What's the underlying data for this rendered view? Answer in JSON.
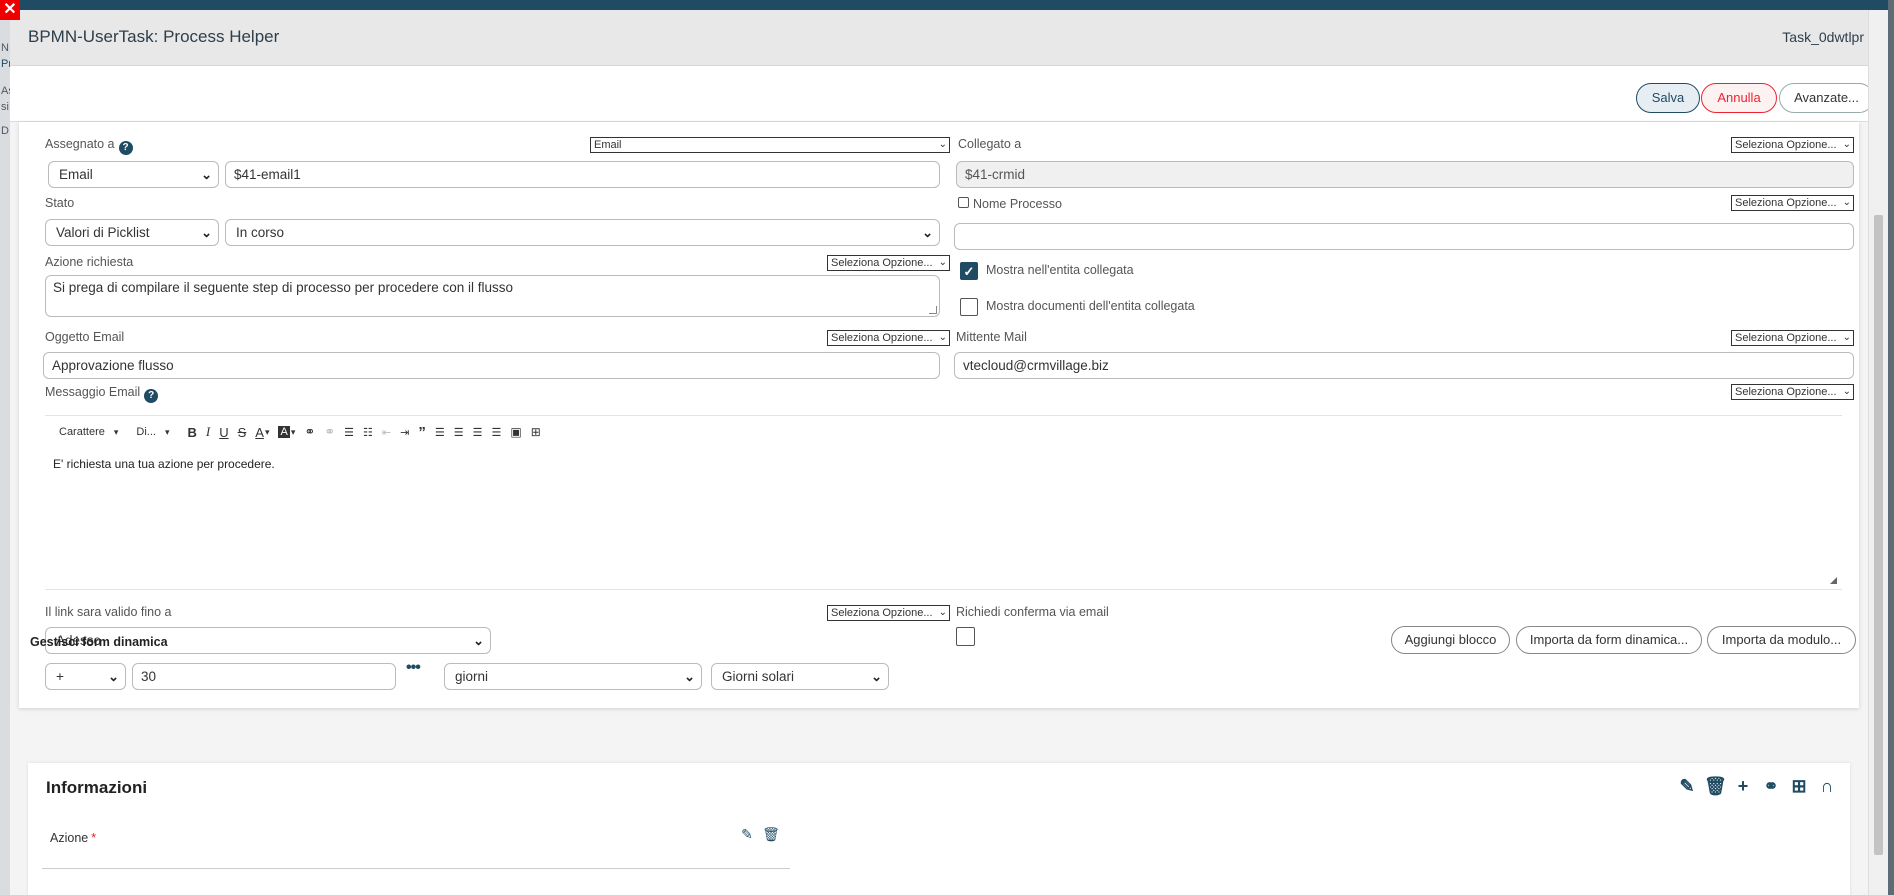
{
  "background": {
    "left_letters": [
      "N",
      "Pr",
      "As",
      "si",
      "D"
    ]
  },
  "modal": {
    "title": "BPMN-UserTask: Process Helper",
    "task_id": "Task_0dwtlpr",
    "close_glyph": "✕"
  },
  "toolbar": {
    "save_label": "Salva",
    "cancel_label": "Annulla",
    "advanced_label": "Avanzate..."
  },
  "form": {
    "assigned_label": "Assegnato a",
    "assigned_mini_select": "Email",
    "assigned_type": "Email",
    "assigned_value": "$41-email1",
    "linked_label": "Collegato a",
    "linked_option": "Seleziona Opzione...",
    "linked_value": "$41-crmid",
    "status_label": "Stato",
    "status_type": "Valori di Picklist",
    "status_value": "In corso",
    "process_name_label": "Nome Processo",
    "process_name_option": "Seleziona Opzione...",
    "process_name_value": "",
    "action_label": "Azione richiesta",
    "action_option": "Seleziona Opzione...",
    "action_value": "Si prega di compilare il seguente step di processo per procedere con il flusso",
    "show_in_entity_label": "Mostra nell'entita collegata",
    "show_in_entity_checked": true,
    "show_docs_label": "Mostra documenti dell'entita collegata",
    "show_docs_checked": false,
    "email_subject_label": "Oggetto Email",
    "email_subject_option": "Seleziona Opzione...",
    "email_subject_value": "Approvazione flusso",
    "sender_label": "Mittente Mail",
    "sender_option": "Seleziona Opzione...",
    "sender_value": "vtecloud@crmvillage.biz",
    "message_label": "Messaggio Email",
    "message_option": "Seleziona Opzione...",
    "editor_font_label": "Carattere",
    "editor_size_label": "Di...",
    "message_body": "E' richiesta una tua azione per procedere.",
    "link_valid_label": "Il link sara valido fino a",
    "link_valid_option": "Seleziona Opzione...",
    "link_valid_value": "Adesso",
    "confirm_email_label": "Richiedi conferma via email",
    "confirm_email_checked": false,
    "offset_sign": "+",
    "offset_amount": "30",
    "offset_unit": "giorni",
    "offset_day_type": "Giorni solari"
  },
  "dynamic_form": {
    "section_title": "Gestisci form dinamica",
    "add_block_label": "Aggiungi blocco",
    "import_form_label": "Importa da form dinamica...",
    "import_module_label": "Importa da modulo...",
    "block_title": "Informazioni",
    "field_label": "Azione",
    "required_marker": "*"
  },
  "colors": {
    "accent": "#1f4b63",
    "danger": "#ee2233"
  }
}
